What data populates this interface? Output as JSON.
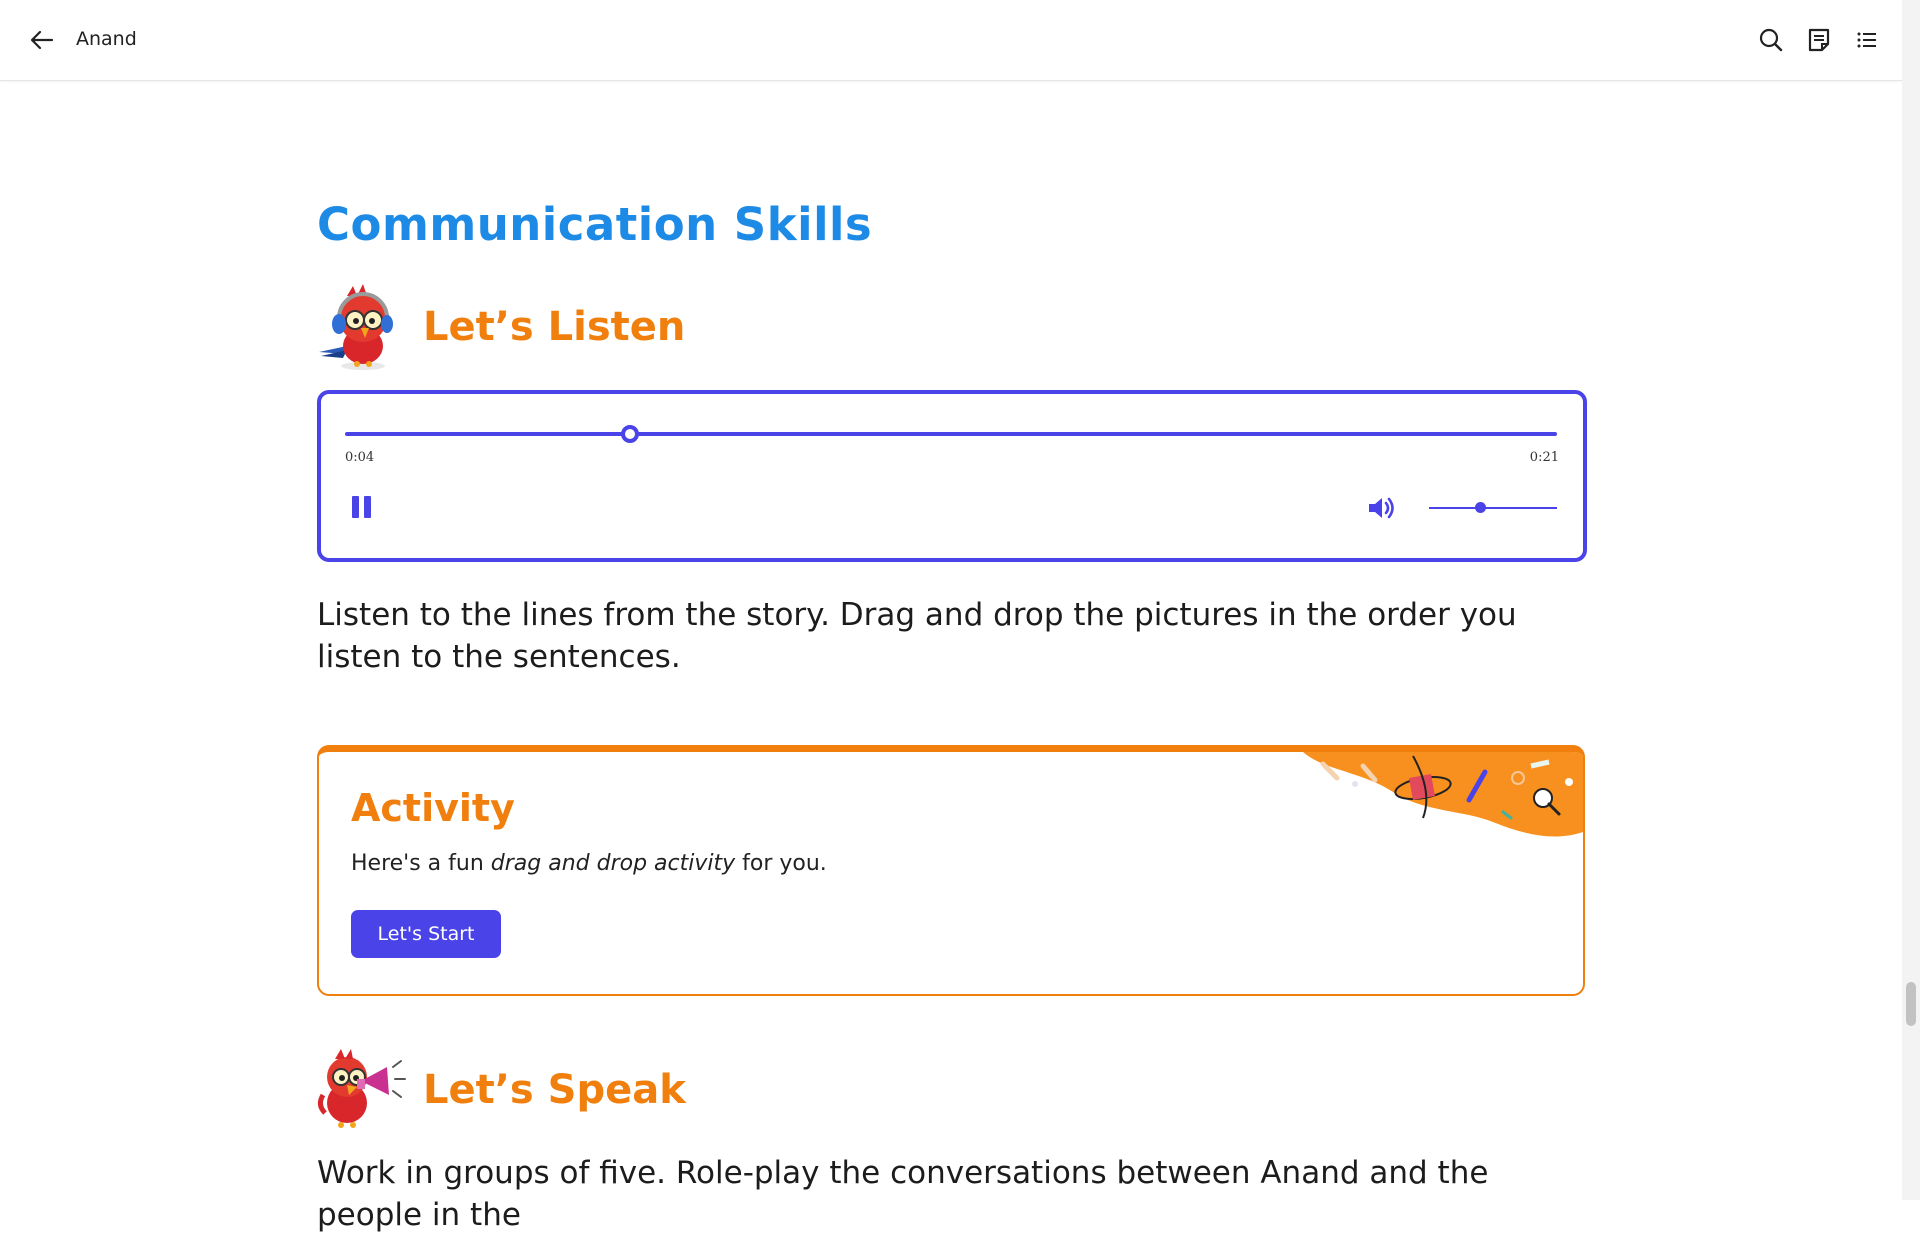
{
  "header": {
    "title": "Anand",
    "back_icon": "arrow-left-icon",
    "actions": [
      "search-icon",
      "notes-icon",
      "table-of-contents-icon"
    ]
  },
  "page": {
    "section_title": "Communication Skills",
    "listen": {
      "heading": "Let’s Listen",
      "mascot": "parrot-with-headphones"
    },
    "audio_player": {
      "current_time": "0:04",
      "duration": "0:21",
      "progress": 0.235,
      "state": "playing",
      "volume": 0.4,
      "accent_color": "#4a43e8"
    },
    "listen_instructions": "Listen to the lines from the story. Drag and drop the pictures in the order you listen to the sentences.",
    "activity": {
      "title": "Activity",
      "desc_prefix": "Here's a fun ",
      "desc_emphasis": "drag and drop activity",
      "desc_suffix": " for you.",
      "button_label": "Let's Start",
      "accent_color": "#f07f0d"
    },
    "speak": {
      "heading": "Let’s Speak",
      "mascot": "parrot-with-megaphone"
    },
    "speak_instructions": "Work in groups of five. Role-play the conversations between Anand and the people in the"
  },
  "colors": {
    "section_title": "#1d8ae6",
    "heading_orange": "#f07f0d",
    "primary": "#4a43e8"
  }
}
